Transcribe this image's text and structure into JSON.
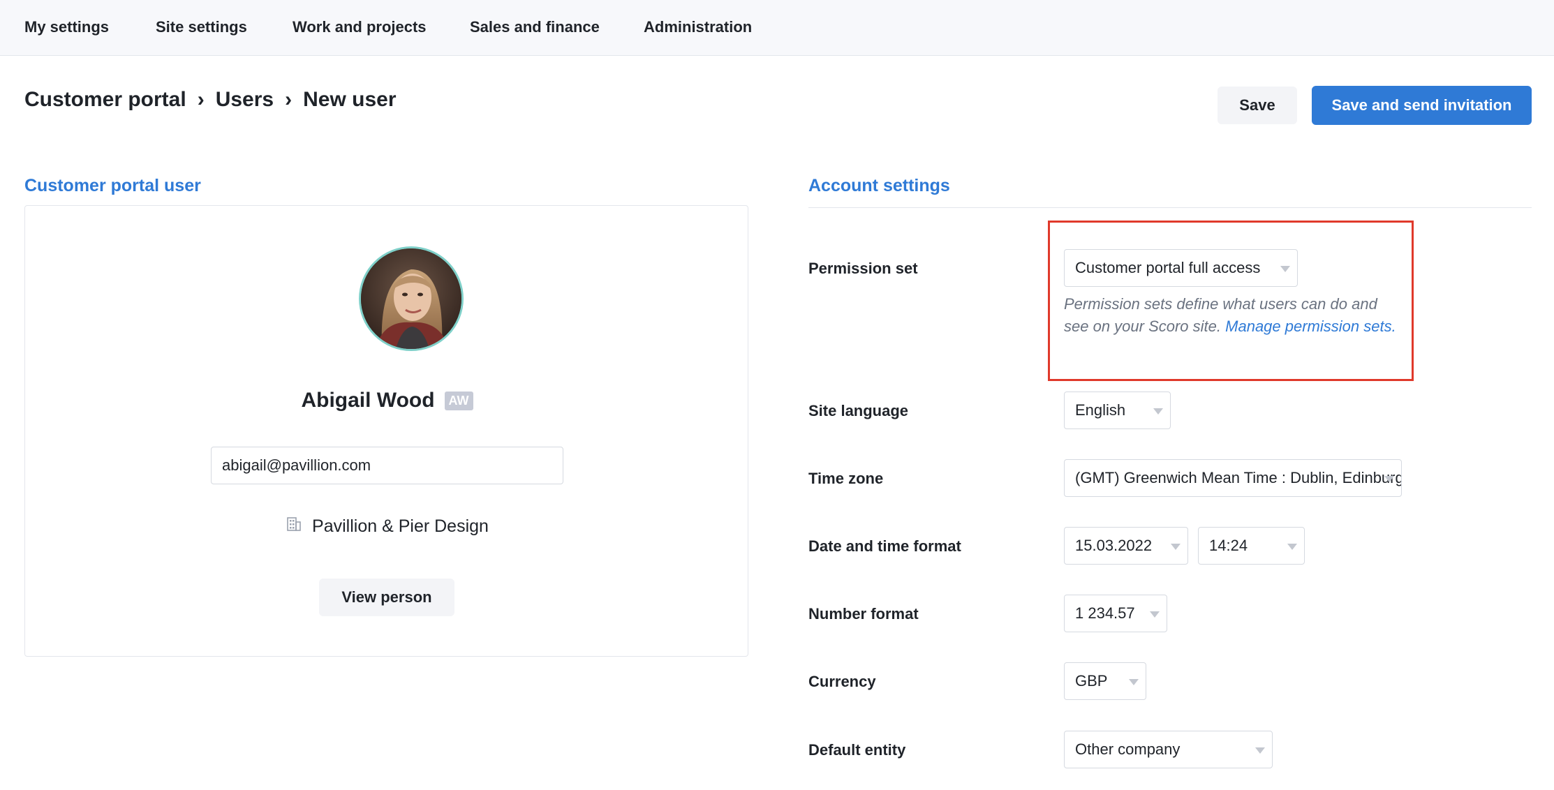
{
  "nav": {
    "items": [
      "My settings",
      "Site settings",
      "Work and projects",
      "Sales and finance",
      "Administration"
    ]
  },
  "breadcrumb": {
    "items": [
      "Customer portal",
      "Users",
      "New user"
    ],
    "separator": "›"
  },
  "actions": {
    "save_label": "Save",
    "save_send_label": "Save and send invitation"
  },
  "left": {
    "section_title": "Customer portal user",
    "user": {
      "name": "Abigail Wood",
      "initials": "AW",
      "email": "abigail@pavillion.com",
      "company": "Pavillion & Pier Design",
      "avatar_icon": "profile-photo"
    },
    "view_person_label": "View person"
  },
  "account": {
    "section_title": "Account settings",
    "permission_set": {
      "label": "Permission set",
      "value": "Customer portal full access",
      "help": "Permission sets define what users can do and see on your Scoro site.",
      "help_link": "Manage permission sets."
    },
    "site_language": {
      "label": "Site language",
      "value": "English"
    },
    "time_zone": {
      "label": "Time zone",
      "value": "(GMT) Greenwich Mean Time : Dublin, Edinburgh, Lisbon, London"
    },
    "date_time_format": {
      "label": "Date and time format",
      "date_value": "15.03.2022",
      "time_value": "14:24"
    },
    "number_format": {
      "label": "Number format",
      "value": "1 234.57"
    },
    "currency": {
      "label": "Currency",
      "value": "GBP"
    },
    "default_entity": {
      "label": "Default entity",
      "value": "Other company"
    }
  },
  "colors": {
    "accent": "#2f7ad6",
    "highlight": "#e0392b",
    "avatar_ring": "#7fd0c9"
  }
}
